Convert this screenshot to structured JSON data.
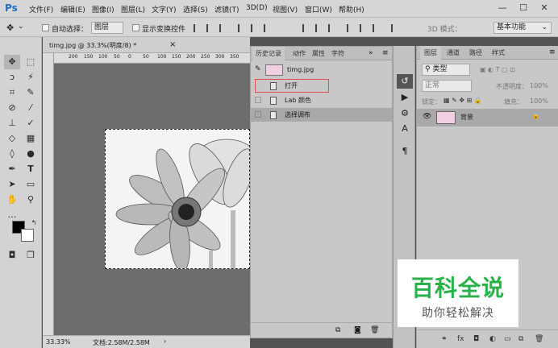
{
  "app": {
    "logo": "Ps"
  },
  "menu": [
    "文件(F)",
    "编辑(E)",
    "图像(I)",
    "图层(L)",
    "文字(Y)",
    "选择(S)",
    "滤镜(T)",
    "3D(D)",
    "视图(V)",
    "窗口(W)",
    "帮助(H)"
  ],
  "window_controls": {
    "minimize": "—",
    "restore": "☐",
    "close": "✕"
  },
  "options": {
    "auto_select_label": "自动选择：",
    "auto_select_value": "图层",
    "show_transform_label": "显示变换控件",
    "mode_3d_label": "3D 模式：",
    "workspace_value": "基本功能"
  },
  "document": {
    "tab_title": "timg.jpg @ 33.3%(明度/8) *",
    "tab_close": "×",
    "ruler_ticks": [
      "200",
      "150",
      "100",
      "50",
      "0",
      "50",
      "100",
      "150",
      "200",
      "250",
      "300",
      "350",
      "400",
      "450"
    ],
    "zoom": "33.33%",
    "doc_size": "文档:2.58M/2.58M"
  },
  "history": {
    "tabs": [
      "历史记录",
      "动作",
      "属性",
      "字符"
    ],
    "collapse": "»",
    "menu": "≡",
    "snapshot_name": "timg.jpg",
    "rows": [
      "打开",
      "Lab 颜色",
      "选择调布"
    ]
  },
  "layers": {
    "tabs": [
      "图层",
      "通道",
      "路径",
      "样式"
    ],
    "filter_label": "类型",
    "blend_mode": "正常",
    "opacity_label": "不透明度：",
    "opacity_value": "100%",
    "lock_label": "锁定：",
    "fill_label": "填充：",
    "fill_value": "100%",
    "layer_name": "背景"
  },
  "colors": {
    "accent_highlight": "#e05050",
    "watermark_green": "#2bb14a"
  },
  "watermark": {
    "title": "百科全说",
    "subtitle": "助你轻松解决"
  }
}
